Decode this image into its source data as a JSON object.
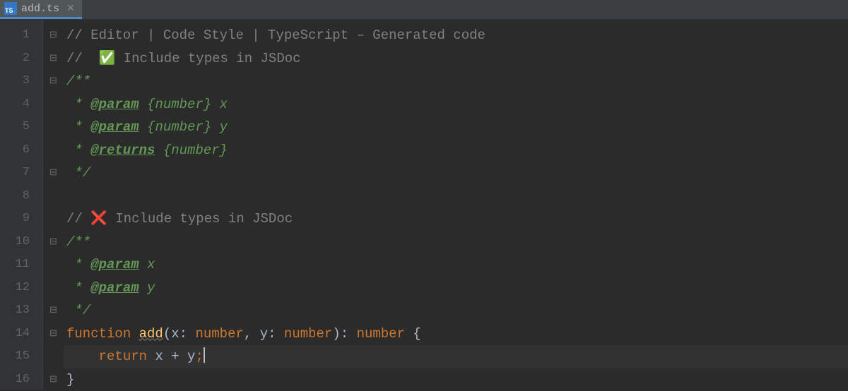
{
  "tab": {
    "filename": "add.ts",
    "icon_label": "TS"
  },
  "gutter_lines": [
    "1",
    "2",
    "3",
    "4",
    "5",
    "6",
    "7",
    "8",
    "9",
    "10",
    "11",
    "12",
    "13",
    "14",
    "15",
    "16"
  ],
  "fold_marks": [
    "⊟",
    "⊟",
    "⊟",
    "",
    "",
    "",
    "⊟",
    "",
    "",
    "⊟",
    "",
    "",
    "⊟",
    "⊟",
    "",
    "⊟"
  ],
  "code": {
    "l1": {
      "slashes": "// ",
      "text": "Editor | Code Style | TypeScript – Generated code"
    },
    "l2": {
      "slashes": "//  ",
      "check": "✅",
      "text": " Include types in JSDoc"
    },
    "l3": {
      "open": "/**"
    },
    "l4": {
      "star": " * ",
      "tag": "@param",
      "rest": " {number} x"
    },
    "l5": {
      "star": " * ",
      "tag": "@param",
      "rest": " {number} y"
    },
    "l6": {
      "star": " * ",
      "tag": "@returns",
      "rest": " {number}"
    },
    "l7": {
      "close": " */"
    },
    "l9": {
      "slashes": "// ",
      "cross": "❌",
      "text": " Include types in JSDoc"
    },
    "l10": {
      "open": "/**"
    },
    "l11": {
      "star": " * ",
      "tag": "@param",
      "rest": " x"
    },
    "l12": {
      "star": " * ",
      "tag": "@param",
      "rest": " y"
    },
    "l13": {
      "close": " */"
    },
    "l14": {
      "kw_function": "function",
      "sp1": " ",
      "name": "add",
      "open_paren": "(",
      "p1": "x",
      "colon1": ": ",
      "t1": "number",
      "comma": ", ",
      "p2": "y",
      "colon2": ": ",
      "t2": "number",
      "close_paren": ")",
      "colon3": ": ",
      "t3": "number",
      "sp2": " ",
      "brace": "{"
    },
    "l15": {
      "indent": "    ",
      "kw_return": "return",
      "sp": " ",
      "expr": "x + y",
      "semi": ";"
    },
    "l16": {
      "brace": "}"
    }
  }
}
